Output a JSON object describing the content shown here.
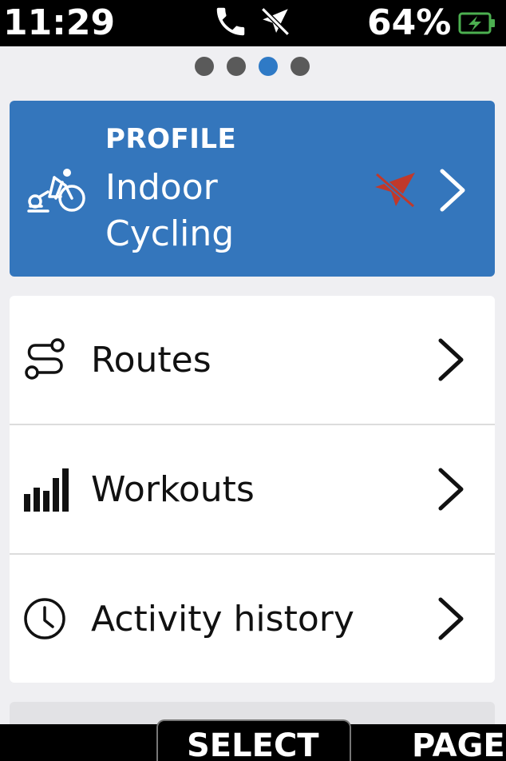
{
  "status_bar": {
    "time": "11:29",
    "battery_percent": "64%",
    "icons": [
      "phone-icon",
      "gps-off-icon",
      "battery-charging-icon"
    ]
  },
  "pager": {
    "count": 4,
    "active_index": 2,
    "active_color": "#2f7ac6",
    "inactive_color": "#5a5a5a"
  },
  "profile": {
    "kicker": "PROFILE",
    "name_line1": "Indoor",
    "name_line2": "Cycling",
    "background_color": "#3476bc",
    "icons": [
      "indoor-bike-icon",
      "gps-disabled-icon",
      "chevron-right-icon"
    ]
  },
  "menu": {
    "items": [
      {
        "label": "Routes",
        "icon": "route-icon"
      },
      {
        "label": "Workouts",
        "icon": "workout-bars-icon"
      },
      {
        "label": "Activity history",
        "icon": "clock-icon"
      }
    ]
  },
  "softkeys": {
    "select": "SELECT",
    "page": "PAGE"
  }
}
